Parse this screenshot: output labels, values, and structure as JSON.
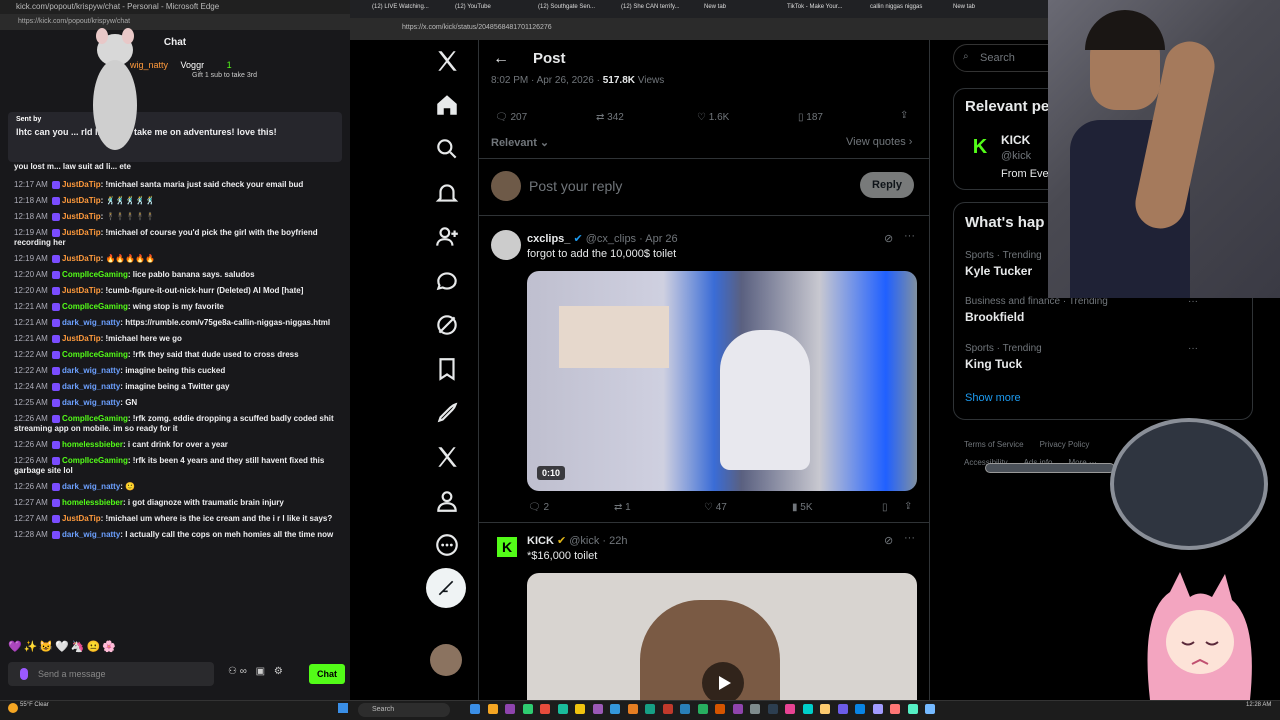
{
  "left_window": {
    "title": "kick.com/popout/krispyw/chat - Personal - Microsoft Edge",
    "url": "https://kick.com/popout/krispyw/chat",
    "chat_header": "Chat",
    "gifter_name": "Voggr",
    "gifter_user": "wig_natty",
    "gifter_count": "1",
    "gifter_text": "Gift 1 sub to take 3rd",
    "pinned_sent_by": "Sent by",
    "pinned_text": "lhtc can you ... rld like this! take me on adventures! love this!",
    "lost_line": "you lost m... law suit ad li... ete",
    "messages": [
      {
        "time": "12:17 AM",
        "user": "JustDaTip",
        "text": "!michael santa maria just said check your email bud"
      },
      {
        "time": "12:18 AM",
        "user": "JustDaTip",
        "text": "🕺🕺🕺🕺🕺"
      },
      {
        "time": "12:18 AM",
        "user": "JustDaTip",
        "text": "🕴🕴🕴🕴🕴"
      },
      {
        "time": "12:19 AM",
        "user": "JustDaTip",
        "text": "!michael of course you'd pick the girl with the boyfriend recording her"
      },
      {
        "time": "12:19 AM",
        "user": "JustDaTip",
        "text": "🔥🔥🔥🔥🔥"
      },
      {
        "time": "12:20 AM",
        "user": "ComplIceGaming",
        "text": "lice pablo banana says. saludos"
      },
      {
        "time": "12:20 AM",
        "user": "JustDaTip",
        "text": "!cumb-figure-it-out-nick-hurr (Deleted) AI Mod [hate]"
      },
      {
        "time": "12:21 AM",
        "user": "ComplIceGaming",
        "text": "wing stop is my favorite"
      },
      {
        "time": "12:21 AM",
        "user": "dark_wig_natty",
        "text": "https://rumble.com/v75ge8a-callin-niggas-niggas.html"
      },
      {
        "time": "12:21 AM",
        "user": "JustDaTip",
        "text": "!michael here we go"
      },
      {
        "time": "12:22 AM",
        "user": "ComplIceGaming",
        "text": "!rfk they said that dude used to cross dress"
      },
      {
        "time": "12:22 AM",
        "user": "dark_wig_natty",
        "text": "imagine being this cucked"
      },
      {
        "time": "12:24 AM",
        "user": "dark_wig_natty",
        "text": "imagine being a Twitter gay"
      },
      {
        "time": "12:25 AM",
        "user": "dark_wig_natty",
        "text": "GN"
      },
      {
        "time": "12:26 AM",
        "user": "ComplIceGaming",
        "text": "!rfk zomg. eddie dropping a scuffed badly coded shit streaming app on mobile. im so ready for it"
      },
      {
        "time": "12:26 AM",
        "user": "homelessbieber",
        "text": "i cant drink for over a year"
      },
      {
        "time": "12:26 AM",
        "user": "ComplIceGaming",
        "text": "!rfk its been 4 years and they still havent fixed this garbage site lol"
      },
      {
        "time": "12:26 AM",
        "user": "dark_wig_natty",
        "text": "🙂"
      },
      {
        "time": "12:27 AM",
        "user": "homelessbieber",
        "text": "i got diagnoze with traumatic brain injury"
      },
      {
        "time": "12:27 AM",
        "user": "JustDaTip",
        "text": "!michael um where is the ice cream and the i r l like it says?"
      },
      {
        "time": "12:28 AM",
        "user": "dark_wig_natty",
        "text": "I actually call the cops on meh homies all the time now"
      }
    ],
    "emote_row": "💜✨😺🤍🦄😐🌸",
    "input_placeholder": "Send a message",
    "chat_button": "Chat"
  },
  "browser": {
    "tabs": [
      "(12) LIVE Watching...",
      "(12) YouTube",
      "(12) Southgate Sen...",
      "(12) She CAN terrify...",
      "New tab",
      "TikTok - Make Your...",
      "callin niggas niggas",
      "New tab"
    ],
    "url": "https://x.com/kick/status/2048568481701126276"
  },
  "x": {
    "header_title": "Post",
    "meta_time": "8:02 PM · Apr 26, 2026 · ",
    "meta_views": "517.8K",
    "meta_views_label": " Views",
    "actions": {
      "replies": "207",
      "reposts": "342",
      "likes": "1.6K",
      "bookmarks": "187"
    },
    "sort": "Relevant",
    "view_quotes": "View quotes",
    "reply_placeholder": "Post your reply",
    "reply_button": "Reply",
    "tweet1": {
      "name": "cxclips_",
      "handle": "@cx_clips",
      "date": "· Apr 26",
      "text": "forgot to add the 10,000$ toilet",
      "duration": "0:10",
      "replies": "2",
      "reposts": "1",
      "likes": "47",
      "views": "5K"
    },
    "tweet2": {
      "name": "KICK",
      "handle": "@kick",
      "date": "· 22h",
      "text": "*$16,000 toilet"
    },
    "search_placeholder": "Search",
    "relevant_people": "Relevant pe",
    "kick_name": "KICK",
    "kick_handle": "@kick",
    "kick_bio": "From Eve",
    "whats_happening": "What's hap",
    "trends": [
      {
        "context": "Sports · Trending",
        "name": "Kyle Tucker"
      },
      {
        "context": "Business and finance · Trending",
        "name": "Brookfield"
      },
      {
        "context": "Sports · Trending",
        "name": "King Tuck"
      }
    ],
    "show_more": "Show more",
    "footer": [
      "Terms of Service",
      "Privacy Policy",
      "Accessibility",
      "Ads info",
      "More ···"
    ]
  },
  "taskbar": {
    "search": "Search",
    "weather": "55°F Clear",
    "clock": "12:28 AM"
  },
  "colors": {
    "kick_green": "#53fc18",
    "x_blue": "#1d9bf0"
  }
}
